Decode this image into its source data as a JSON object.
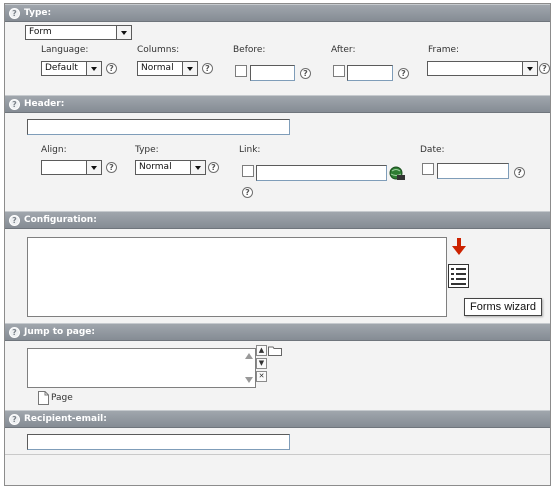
{
  "sections": {
    "type": {
      "header": "Type:",
      "type_value": "Form",
      "language_label": "Language:",
      "language_value": "Default",
      "columns_label": "Columns:",
      "columns_value": "Normal",
      "before_label": "Before:",
      "after_label": "After:",
      "frame_label": "Frame:",
      "frame_value": ""
    },
    "header": {
      "header": "Header:",
      "header_value": "",
      "align_label": "Align:",
      "align_value": "",
      "type_label": "Type:",
      "type_value": "Normal",
      "link_label": "Link:",
      "link_value": "",
      "date_label": "Date:",
      "date_value": ""
    },
    "configuration": {
      "header": "Configuration:",
      "tooltip": "Forms wizard"
    },
    "jump_to_page": {
      "header": "Jump to page:",
      "page_label": "Page"
    },
    "recipient": {
      "header": "Recipient-email:",
      "value": ""
    }
  },
  "help_glyph": "?",
  "colors": {
    "section_header": "#8e949b",
    "arrow_red": "#cc2200",
    "background": "#f3f3f3"
  },
  "icons": {
    "help": "help-icon",
    "link_browser": "link-browser-icon",
    "wizard": "forms-wizard-icon",
    "arrow": "red-arrow-down-icon",
    "page": "page-icon",
    "folder": "folder-icon"
  }
}
